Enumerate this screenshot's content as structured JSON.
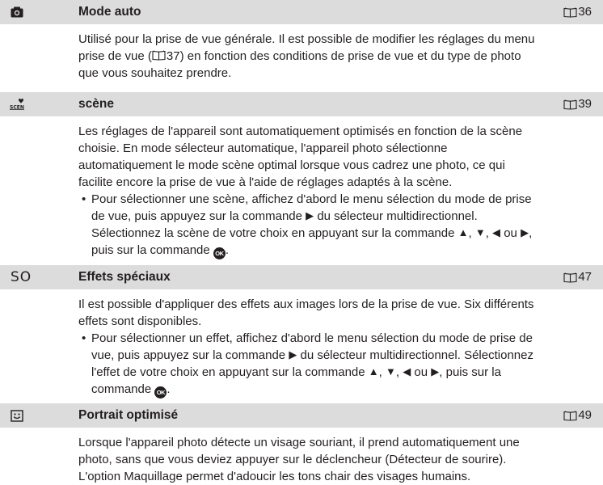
{
  "sections": [
    {
      "icon": "camera-icon",
      "title": "Mode auto",
      "ref": "36",
      "paragraph": [
        "Utilisé pour la prise de vue générale. Il est possible de modifier les réglages du menu",
        "prise de vue (",
        "37) en fonction des conditions de prise de vue et du type de photo",
        "que vous souhaitez prendre."
      ]
    },
    {
      "icon": "scene-icon",
      "title": "scène",
      "ref": "39",
      "paragraph": [
        "Les réglages de l'appareil sont automatiquement optimisés en fonction de la scène",
        "choisie. En mode sélecteur automatique, l'appareil photo sélectionne",
        "automatiquement le mode scène optimal lorsque vous cadrez une photo, ce qui",
        "facilite encore la prise de vue à l'aide de réglages adaptés à la scène."
      ],
      "bullet": {
        "l1": "Pour sélectionner une scène, affichez d'abord le menu sélection du mode de prise",
        "l2a": "de vue, puis appuyez sur la commande ",
        "l2b": " du sélecteur multidirectionnel.",
        "l3a": "Sélectionnez la scène de votre choix en appuyant sur la commande ",
        "sep1": ", ",
        "sep2": ", ",
        "or": " ou ",
        "end": ",",
        "l4a": "puis sur la commande ",
        "l4b": "."
      }
    },
    {
      "icon_text": "SO",
      "title": "Effets spéciaux",
      "ref": "47",
      "paragraph": [
        "Il est possible d'appliquer des effets aux images lors de la prise de vue. Six différents",
        "effets sont disponibles."
      ],
      "bullet": {
        "l1": "Pour sélectionner un effet, affichez d'abord le menu sélection du mode de prise de",
        "l2a": "vue, puis appuyez sur la commande ",
        "l2b": " du sélecteur multidirectionnel. Sélectionnez",
        "l3a": "l'effet de votre choix en appuyant sur la commande ",
        "sep1": ", ",
        "sep2": ", ",
        "or": " ou ",
        "l3b": ", puis sur la",
        "l4a": "commande ",
        "l4b": "."
      }
    },
    {
      "icon": "smile-portrait-icon",
      "title": "Portrait optimisé",
      "ref": "49",
      "paragraph": [
        "Lorsque l'appareil photo détecte un visage souriant, il prend automatiquement une",
        "photo, sans que vous deviez appuyer sur le déclencheur (Détecteur de sourire).",
        "L'option Maquillage permet d'adoucir les tons chair des visages humains."
      ]
    }
  ],
  "glyphs": {
    "bullet": "•",
    "right": "▶",
    "up": "▲",
    "down": "▼",
    "left": "◀",
    "ok": "OK"
  },
  "colors": {
    "header_bg": "#dcdcdc",
    "text": "#231f20"
  }
}
